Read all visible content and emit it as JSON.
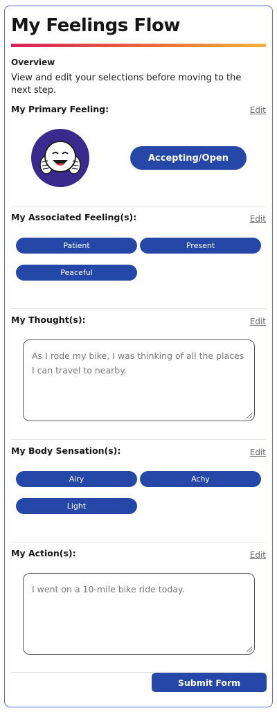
{
  "page": {
    "title": "My Feelings Flow"
  },
  "overview": {
    "heading": "Overview",
    "description": "View and edit your selections before moving to the next step."
  },
  "edit_label": "Edit",
  "primary_feeling": {
    "label": "My Primary Feeling:",
    "value": "Accepting/Open",
    "icon": "smiling-face-icon"
  },
  "associated_feelings": {
    "label": "My Associated Feeling(s):",
    "items": [
      "Patient",
      "Present",
      "Peaceful"
    ]
  },
  "thoughts": {
    "label": "My Thought(s):",
    "text": "As I rode my bike, I was thinking of all the places I can travel to nearby."
  },
  "body_sensations": {
    "label": "My Body Sensation(s):",
    "items": [
      "Airy",
      "Achy",
      "Light"
    ]
  },
  "actions": {
    "label": "My Action(s):",
    "text": "I went on a 10-mile bike ride today."
  },
  "submit_label": "Submit Form",
  "colors": {
    "accent": "#2447a8",
    "avatar_bg": "#3a2a8e",
    "gradient_start": "#d91f5a",
    "gradient_end": "#f2b23b"
  }
}
